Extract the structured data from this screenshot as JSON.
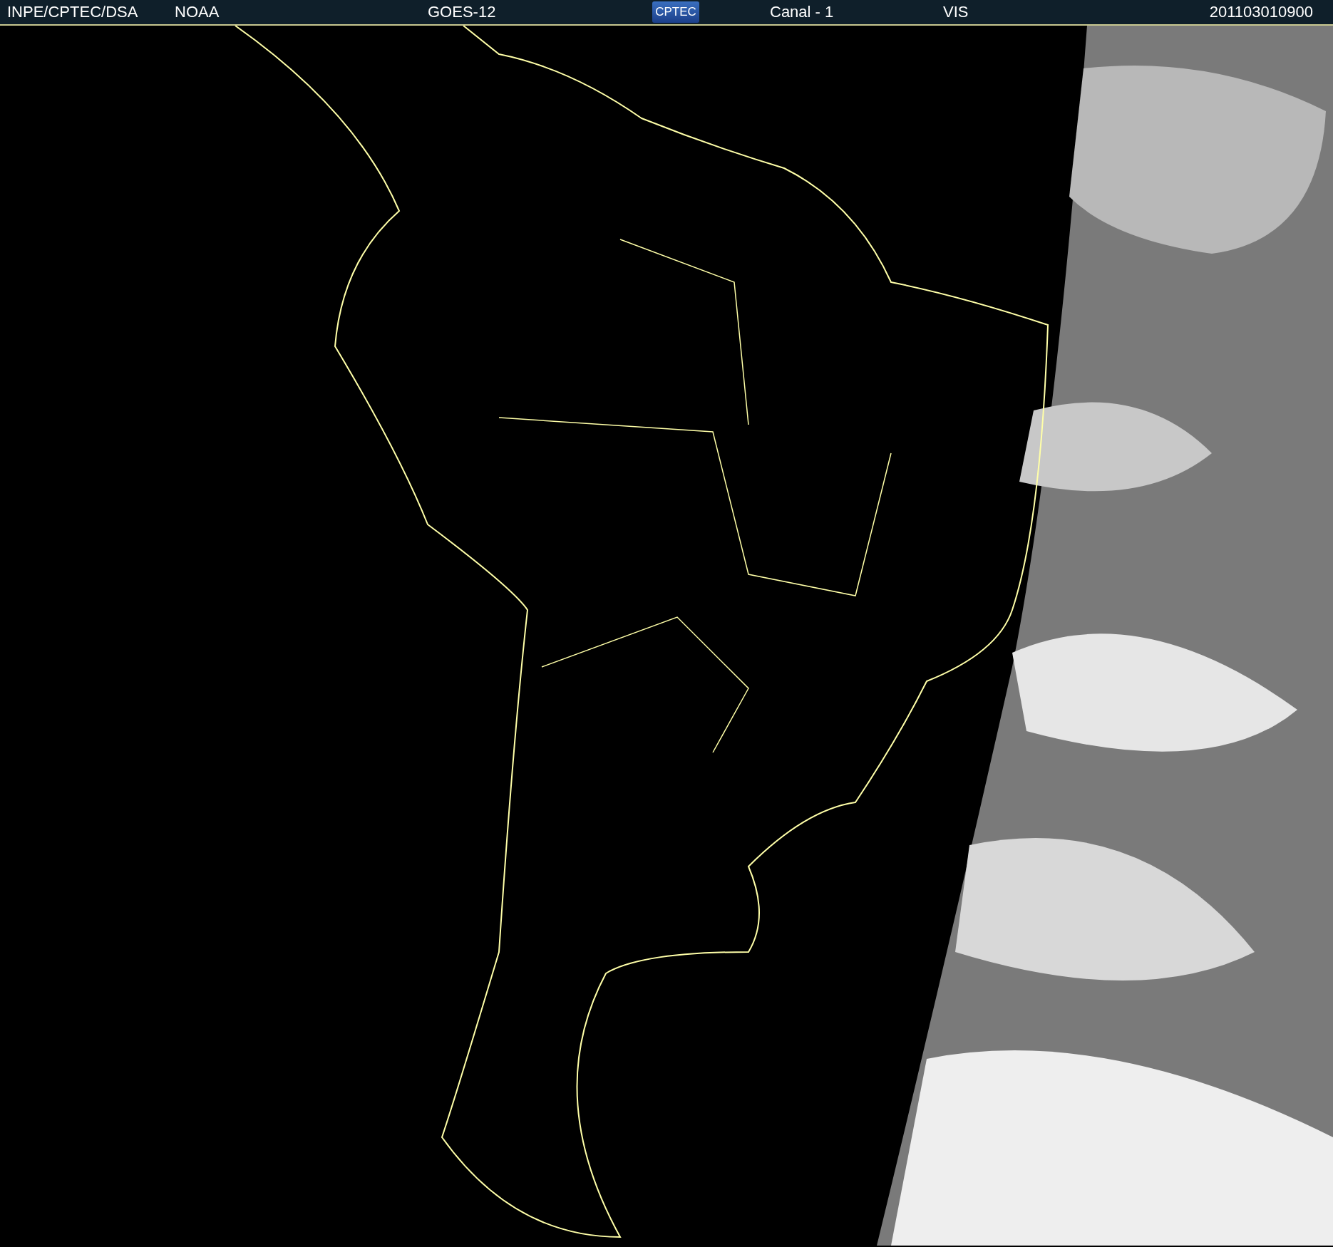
{
  "header": {
    "labels": [
      "INPE/CPTEC/DSA",
      "NOAA",
      "GOES-12"
    ],
    "logo": "CPTEC",
    "channel": "Canal - 1",
    "band": "VIS",
    "timestamp": "201103010900"
  }
}
